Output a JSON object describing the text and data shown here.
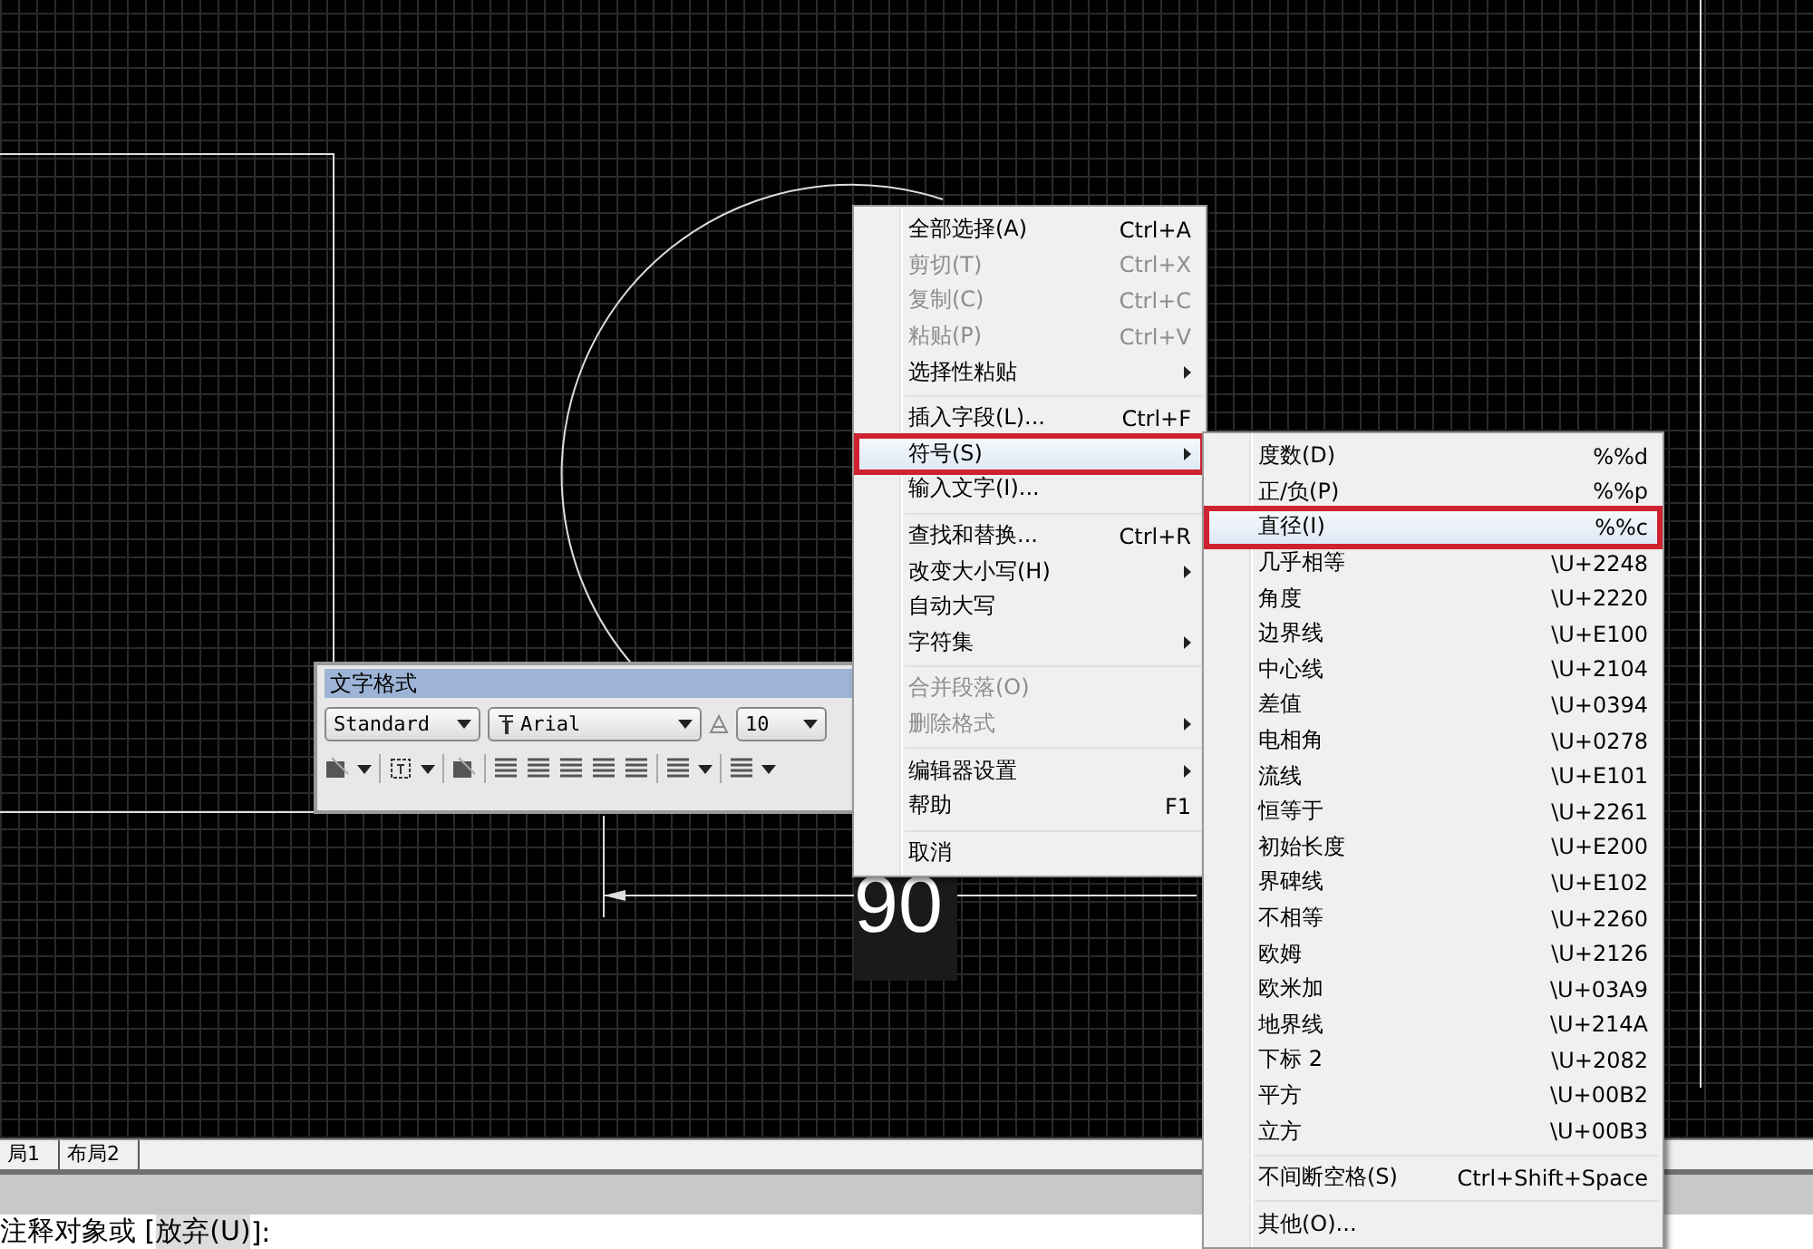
{
  "canvas": {
    "dimension_text": "90"
  },
  "text_format_toolbar": {
    "title": "文字格式",
    "style": "Standard",
    "font": "Arial",
    "size": "10"
  },
  "context_menu": {
    "items": [
      {
        "kind": "item",
        "label": "全部选择(A)",
        "shortcut": "Ctrl+A",
        "disabled": false,
        "submenu": false,
        "selected": false
      },
      {
        "kind": "item",
        "label": "剪切(T)",
        "shortcut": "Ctrl+X",
        "disabled": true,
        "submenu": false,
        "selected": false
      },
      {
        "kind": "item",
        "label": "复制(C)",
        "shortcut": "Ctrl+C",
        "disabled": true,
        "submenu": false,
        "selected": false
      },
      {
        "kind": "item",
        "label": "粘贴(P)",
        "shortcut": "Ctrl+V",
        "disabled": true,
        "submenu": false,
        "selected": false
      },
      {
        "kind": "item",
        "label": "选择性粘贴",
        "disabled": false,
        "submenu": true,
        "selected": false
      },
      {
        "kind": "separator"
      },
      {
        "kind": "item",
        "label": "插入字段(L)...",
        "shortcut": "Ctrl+F",
        "disabled": false,
        "submenu": false,
        "selected": false
      },
      {
        "kind": "item",
        "label": "符号(S)",
        "disabled": false,
        "submenu": true,
        "selected": true
      },
      {
        "kind": "item",
        "label": "输入文字(I)...",
        "disabled": false,
        "submenu": false,
        "selected": false
      },
      {
        "kind": "separator"
      },
      {
        "kind": "item",
        "label": "查找和替换...",
        "shortcut": "Ctrl+R",
        "disabled": false,
        "submenu": false,
        "selected": false
      },
      {
        "kind": "item",
        "label": "改变大小写(H)",
        "disabled": false,
        "submenu": true,
        "selected": false
      },
      {
        "kind": "item",
        "label": "自动大写",
        "disabled": false,
        "submenu": false,
        "selected": false
      },
      {
        "kind": "item",
        "label": "字符集",
        "disabled": false,
        "submenu": true,
        "selected": false
      },
      {
        "kind": "separator"
      },
      {
        "kind": "item",
        "label": "合并段落(O)",
        "disabled": true,
        "submenu": false,
        "selected": false
      },
      {
        "kind": "item",
        "label": "删除格式",
        "disabled": true,
        "submenu": true,
        "selected": false
      },
      {
        "kind": "separator"
      },
      {
        "kind": "item",
        "label": "编辑器设置",
        "disabled": false,
        "submenu": true,
        "selected": false
      },
      {
        "kind": "item",
        "label": "帮助",
        "shortcut": "F1",
        "disabled": false,
        "submenu": false,
        "selected": false
      },
      {
        "kind": "separator"
      },
      {
        "kind": "item",
        "label": "取消",
        "disabled": false,
        "submenu": false,
        "selected": false
      }
    ]
  },
  "symbol_submenu": {
    "items": [
      {
        "kind": "item",
        "label": "度数(D)",
        "code": "%%d",
        "selected": false
      },
      {
        "kind": "item",
        "label": "正/负(P)",
        "code": "%%p",
        "selected": false
      },
      {
        "kind": "item",
        "label": "直径(I)",
        "code": "%%c",
        "selected": true
      },
      {
        "kind": "item",
        "label": "几乎相等",
        "code": "\\U+2248",
        "selected": false
      },
      {
        "kind": "item",
        "label": "角度",
        "code": "\\U+2220",
        "selected": false
      },
      {
        "kind": "item",
        "label": "边界线",
        "code": "\\U+E100",
        "selected": false
      },
      {
        "kind": "item",
        "label": "中心线",
        "code": "\\U+2104",
        "selected": false
      },
      {
        "kind": "item",
        "label": "差值",
        "code": "\\U+0394",
        "selected": false
      },
      {
        "kind": "item",
        "label": "电相角",
        "code": "\\U+0278",
        "selected": false
      },
      {
        "kind": "item",
        "label": "流线",
        "code": "\\U+E101",
        "selected": false
      },
      {
        "kind": "item",
        "label": "恒等于",
        "code": "\\U+2261",
        "selected": false
      },
      {
        "kind": "item",
        "label": "初始长度",
        "code": "\\U+E200",
        "selected": false
      },
      {
        "kind": "item",
        "label": "界碑线",
        "code": "\\U+E102",
        "selected": false
      },
      {
        "kind": "item",
        "label": "不相等",
        "code": "\\U+2260",
        "selected": false
      },
      {
        "kind": "item",
        "label": "欧姆",
        "code": "\\U+2126",
        "selected": false
      },
      {
        "kind": "item",
        "label": "欧米加",
        "code": "\\U+03A9",
        "selected": false
      },
      {
        "kind": "item",
        "label": "地界线",
        "code": "\\U+214A",
        "selected": false
      },
      {
        "kind": "item",
        "label": "下标 2",
        "code": "\\U+2082",
        "selected": false
      },
      {
        "kind": "item",
        "label": "平方",
        "code": "\\U+00B2",
        "selected": false
      },
      {
        "kind": "item",
        "label": "立方",
        "code": "\\U+00B3",
        "selected": false
      },
      {
        "kind": "separator"
      },
      {
        "kind": "item",
        "label": "不间断空格(S)",
        "code": "Ctrl+Shift+Space",
        "selected": false
      },
      {
        "kind": "separator"
      },
      {
        "kind": "item",
        "label": "其他(O)...",
        "selected": false
      }
    ]
  },
  "layout_tabs": [
    {
      "label": "局1"
    },
    {
      "label": "布局2"
    }
  ],
  "command_line": {
    "prompt": "注释对象或 [",
    "option": "放弃(U)",
    "end": "]:"
  }
}
